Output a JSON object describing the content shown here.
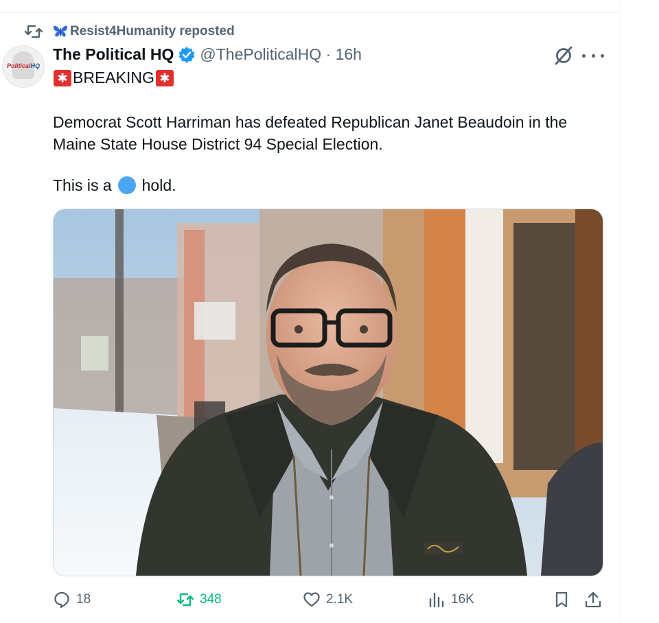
{
  "repost": {
    "user": "Resist4Humanity",
    "label": "reposted"
  },
  "author": {
    "name": "The Political HQ",
    "handle": "@ThePoliticalHQ",
    "separator": "·",
    "time": "16h",
    "avatar_text_1": "Political",
    "avatar_text_2": "HQ"
  },
  "post": {
    "breaking": "BREAKING",
    "body": "Democrat Scott Harriman has defeated Republican Janet Beaudoin in the Maine State House District 94 Special Election.",
    "hold_prefix": "This is a",
    "hold_suffix": "hold."
  },
  "actions": {
    "replies": "18",
    "reposts": "348",
    "likes": "2.1K",
    "views": "16K"
  },
  "colors": {
    "accent": "#1d9bf0",
    "repost_green": "#00ba7c",
    "muted": "#536471",
    "siren": "#e0312d",
    "blue_circle": "#4aa6f3"
  },
  "icons": [
    "repost-icon",
    "butterfly-icon",
    "verified-badge-icon",
    "grok-icon",
    "more-icon",
    "siren-icon",
    "reply-icon",
    "like-icon",
    "views-icon",
    "bookmark-icon",
    "share-icon"
  ]
}
